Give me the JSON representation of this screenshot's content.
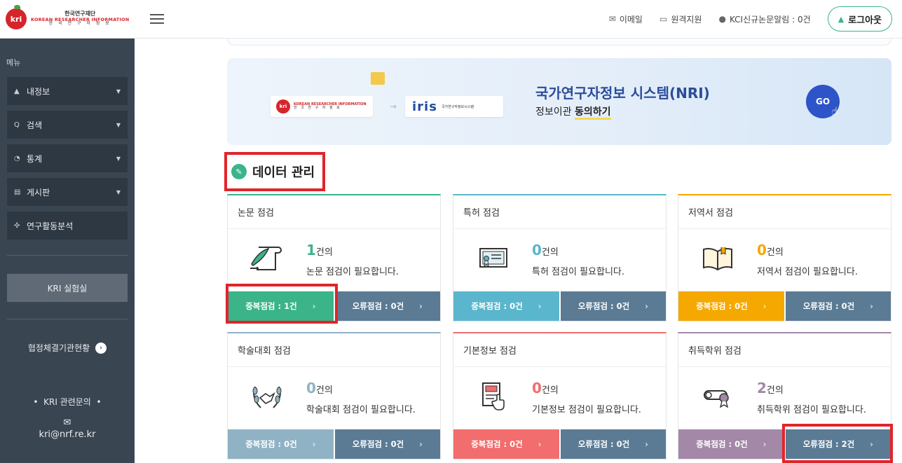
{
  "header": {
    "logo": {
      "kri": "kri",
      "org_kr": "한국연구재단",
      "org_en": "KOREAN RESEARCHER INFORMATION",
      "org_kr2": "한 국 연 구 자 정 보"
    },
    "links": [
      {
        "label": "이메일",
        "icon": "mail-icon"
      },
      {
        "label": "원격지원",
        "icon": "monitor-icon"
      },
      {
        "label": "KCI신규논문알림 : 0건",
        "icon": "bell-icon"
      }
    ],
    "logout_label": "로그아웃"
  },
  "sidebar": {
    "title": "메뉴",
    "items": [
      {
        "label": "내정보",
        "icon": "user-icon",
        "has_caret": true
      },
      {
        "label": "검색",
        "icon": "search-icon",
        "has_caret": true
      },
      {
        "label": "통계",
        "icon": "chart-icon",
        "has_caret": true
      },
      {
        "label": "게시판",
        "icon": "board-icon",
        "has_caret": true
      },
      {
        "label": "연구활동분석",
        "icon": "analysis-icon",
        "has_caret": false
      }
    ],
    "lab_label": "KRI 실험실",
    "partner_label": "협정체결기관현황",
    "contact_title": "KRI 관련문의",
    "contact_email": "kri@nrf.re.kr"
  },
  "banner": {
    "title": "국가연구자정보 시스템(NRI)",
    "subtitle_prefix": "정보이관 ",
    "subtitle_bold": "동의하기",
    "go_label": "GO",
    "iris_label": "iris",
    "iris_sub": "국가연구자정보시스템"
  },
  "section": {
    "title": "데이터 관리"
  },
  "cards": [
    {
      "title": "논문 점검",
      "count": "1",
      "unit": "건의",
      "message": "논문 점검이 필요합니다.",
      "count_color": "#3bb48a",
      "dup_label": "중복점검 : 1건",
      "err_label": "오류점검 : 0건",
      "dup_color": "#3bb48a",
      "icon": "scroll-quill-icon"
    },
    {
      "title": "특허 점검",
      "count": "0",
      "unit": "건의",
      "message": "특허 점검이 필요합니다.",
      "count_color": "#5ab6cc",
      "dup_label": "중복점검 : 0건",
      "err_label": "오류점검 : 0건",
      "dup_color": "#5ab6cc",
      "icon": "certificate-icon"
    },
    {
      "title": "저역서 점검",
      "count": "0",
      "unit": "건의",
      "message": "저역서 점검이 필요합니다.",
      "count_color": "#f5a800",
      "dup_label": "중복점검 : 0건",
      "err_label": "오류점검 : 0건",
      "dup_color": "#f5a800",
      "icon": "book-icon"
    },
    {
      "title": "학술대회 점검",
      "count": "0",
      "unit": "건의",
      "message": "학술대회 점검이 필요합니다.",
      "count_color": "#8fb3c4",
      "dup_label": "중복점검 : 0건",
      "err_label": "오류점검 : 0건",
      "dup_color": "#8fb3c4",
      "icon": "laurel-handshake-icon"
    },
    {
      "title": "기본정보 점검",
      "count": "0",
      "unit": "건의",
      "message": "기본정보 점검이 필요합니다.",
      "count_color": "#f26d6d",
      "dup_label": "중복점검 : 0건",
      "err_label": "오류점검 : 0건",
      "dup_color": "#f26d6d",
      "icon": "document-pointer-icon"
    },
    {
      "title": "취득학위 점검",
      "count": "2",
      "unit": "건의",
      "message": "취득학위 점검이 필요합니다.",
      "count_color": "#a488a8",
      "dup_label": "중복점검 : 0건",
      "err_label": "오류점검 : 2건",
      "dup_color": "#a488a8",
      "icon": "diploma-icon"
    }
  ],
  "colors": {
    "sidebar_bg": "#3a4552",
    "highlight": "#e0252b",
    "error_button": "#5b7b94",
    "brand_red": "#d6252a"
  }
}
